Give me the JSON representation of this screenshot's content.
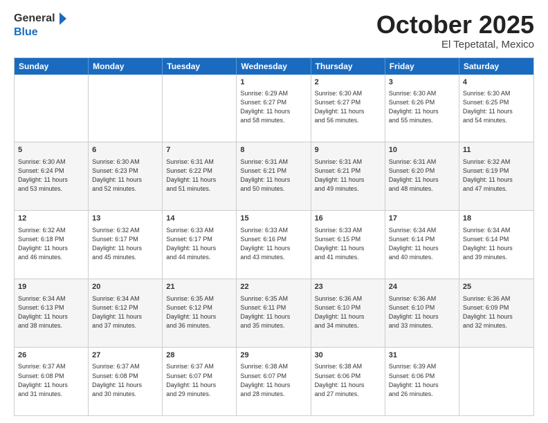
{
  "header": {
    "logo_general": "General",
    "logo_blue": "Blue",
    "title": "October 2025",
    "subtitle": "El Tepetatal, Mexico"
  },
  "days_of_week": [
    "Sunday",
    "Monday",
    "Tuesday",
    "Wednesday",
    "Thursday",
    "Friday",
    "Saturday"
  ],
  "rows": [
    {
      "alt": false,
      "cells": [
        {
          "day": "",
          "info": ""
        },
        {
          "day": "",
          "info": ""
        },
        {
          "day": "",
          "info": ""
        },
        {
          "day": "1",
          "info": "Sunrise: 6:29 AM\nSunset: 6:27 PM\nDaylight: 11 hours\nand 58 minutes."
        },
        {
          "day": "2",
          "info": "Sunrise: 6:30 AM\nSunset: 6:27 PM\nDaylight: 11 hours\nand 56 minutes."
        },
        {
          "day": "3",
          "info": "Sunrise: 6:30 AM\nSunset: 6:26 PM\nDaylight: 11 hours\nand 55 minutes."
        },
        {
          "day": "4",
          "info": "Sunrise: 6:30 AM\nSunset: 6:25 PM\nDaylight: 11 hours\nand 54 minutes."
        }
      ]
    },
    {
      "alt": true,
      "cells": [
        {
          "day": "5",
          "info": "Sunrise: 6:30 AM\nSunset: 6:24 PM\nDaylight: 11 hours\nand 53 minutes."
        },
        {
          "day": "6",
          "info": "Sunrise: 6:30 AM\nSunset: 6:23 PM\nDaylight: 11 hours\nand 52 minutes."
        },
        {
          "day": "7",
          "info": "Sunrise: 6:31 AM\nSunset: 6:22 PM\nDaylight: 11 hours\nand 51 minutes."
        },
        {
          "day": "8",
          "info": "Sunrise: 6:31 AM\nSunset: 6:21 PM\nDaylight: 11 hours\nand 50 minutes."
        },
        {
          "day": "9",
          "info": "Sunrise: 6:31 AM\nSunset: 6:21 PM\nDaylight: 11 hours\nand 49 minutes."
        },
        {
          "day": "10",
          "info": "Sunrise: 6:31 AM\nSunset: 6:20 PM\nDaylight: 11 hours\nand 48 minutes."
        },
        {
          "day": "11",
          "info": "Sunrise: 6:32 AM\nSunset: 6:19 PM\nDaylight: 11 hours\nand 47 minutes."
        }
      ]
    },
    {
      "alt": false,
      "cells": [
        {
          "day": "12",
          "info": "Sunrise: 6:32 AM\nSunset: 6:18 PM\nDaylight: 11 hours\nand 46 minutes."
        },
        {
          "day": "13",
          "info": "Sunrise: 6:32 AM\nSunset: 6:17 PM\nDaylight: 11 hours\nand 45 minutes."
        },
        {
          "day": "14",
          "info": "Sunrise: 6:33 AM\nSunset: 6:17 PM\nDaylight: 11 hours\nand 44 minutes."
        },
        {
          "day": "15",
          "info": "Sunrise: 6:33 AM\nSunset: 6:16 PM\nDaylight: 11 hours\nand 43 minutes."
        },
        {
          "day": "16",
          "info": "Sunrise: 6:33 AM\nSunset: 6:15 PM\nDaylight: 11 hours\nand 41 minutes."
        },
        {
          "day": "17",
          "info": "Sunrise: 6:34 AM\nSunset: 6:14 PM\nDaylight: 11 hours\nand 40 minutes."
        },
        {
          "day": "18",
          "info": "Sunrise: 6:34 AM\nSunset: 6:14 PM\nDaylight: 11 hours\nand 39 minutes."
        }
      ]
    },
    {
      "alt": true,
      "cells": [
        {
          "day": "19",
          "info": "Sunrise: 6:34 AM\nSunset: 6:13 PM\nDaylight: 11 hours\nand 38 minutes."
        },
        {
          "day": "20",
          "info": "Sunrise: 6:34 AM\nSunset: 6:12 PM\nDaylight: 11 hours\nand 37 minutes."
        },
        {
          "day": "21",
          "info": "Sunrise: 6:35 AM\nSunset: 6:12 PM\nDaylight: 11 hours\nand 36 minutes."
        },
        {
          "day": "22",
          "info": "Sunrise: 6:35 AM\nSunset: 6:11 PM\nDaylight: 11 hours\nand 35 minutes."
        },
        {
          "day": "23",
          "info": "Sunrise: 6:36 AM\nSunset: 6:10 PM\nDaylight: 11 hours\nand 34 minutes."
        },
        {
          "day": "24",
          "info": "Sunrise: 6:36 AM\nSunset: 6:10 PM\nDaylight: 11 hours\nand 33 minutes."
        },
        {
          "day": "25",
          "info": "Sunrise: 6:36 AM\nSunset: 6:09 PM\nDaylight: 11 hours\nand 32 minutes."
        }
      ]
    },
    {
      "alt": false,
      "cells": [
        {
          "day": "26",
          "info": "Sunrise: 6:37 AM\nSunset: 6:08 PM\nDaylight: 11 hours\nand 31 minutes."
        },
        {
          "day": "27",
          "info": "Sunrise: 6:37 AM\nSunset: 6:08 PM\nDaylight: 11 hours\nand 30 minutes."
        },
        {
          "day": "28",
          "info": "Sunrise: 6:37 AM\nSunset: 6:07 PM\nDaylight: 11 hours\nand 29 minutes."
        },
        {
          "day": "29",
          "info": "Sunrise: 6:38 AM\nSunset: 6:07 PM\nDaylight: 11 hours\nand 28 minutes."
        },
        {
          "day": "30",
          "info": "Sunrise: 6:38 AM\nSunset: 6:06 PM\nDaylight: 11 hours\nand 27 minutes."
        },
        {
          "day": "31",
          "info": "Sunrise: 6:39 AM\nSunset: 6:06 PM\nDaylight: 11 hours\nand 26 minutes."
        },
        {
          "day": "",
          "info": ""
        }
      ]
    }
  ]
}
